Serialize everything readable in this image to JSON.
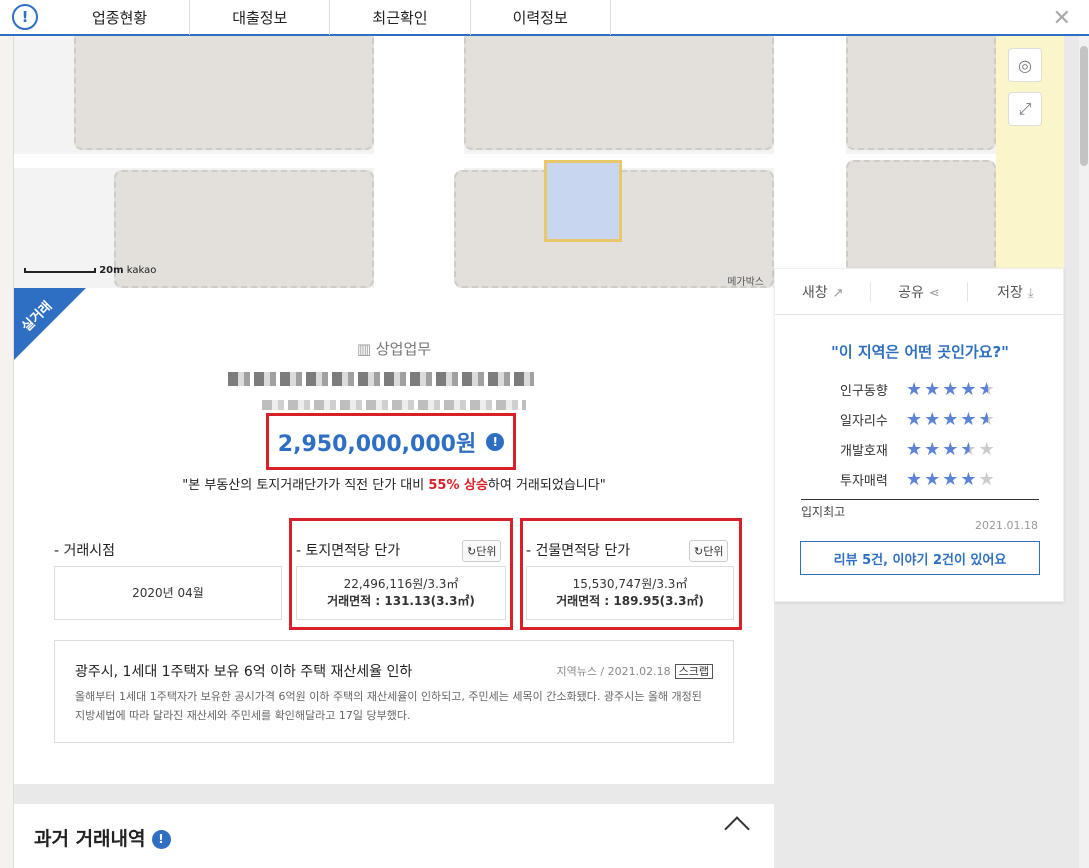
{
  "tabs": [
    "업종현황",
    "대출정보",
    "최근확인",
    "이력정보"
  ],
  "map": {
    "scale_label": "20m",
    "brand": "kakao",
    "poi_label": "메가박스"
  },
  "listing": {
    "badge": "실거래",
    "category": "상업업무",
    "price": "2,950,000,000원",
    "compare_prefix": "\"본 부동산의 토지거래단가가 직전 단가 대비 ",
    "compare_highlight": "55% 상승",
    "compare_suffix": "하여 거래되었습니다\"",
    "trade_time_label": "- 거래시점",
    "trade_time_value": "2020년 04월",
    "land_unit_title": "- 토지면적당 단가",
    "land_unit_price": "22,496,116원/3.3㎡",
    "land_area": "거래면적 : 131.13(3.3㎡)",
    "bldg_unit_title": "- 건물면적당 단가",
    "bldg_unit_price": "15,530,747원/3.3㎡",
    "bldg_area": "거래면적 : 189.95(3.3㎡)",
    "unit_button": "단위"
  },
  "news": {
    "title": "광주시, 1세대 1주택자 보유 6억 이하 주택 재산세율 인하",
    "source": "지역뉴스 / 2021.02.18",
    "scrap": "스크랩",
    "body": "올해부터 1세대 1주택자가 보유한 공시가격 6억원 이하 주택의 재산세율이 인하되고, 주민세는 세목이 간소화됐다. 광주시는 올해 개정된 지방세법에 따라 달라진 재산세와 주민세를 확인해달라고 17일 당부했다."
  },
  "past": {
    "title": "과거 거래내역"
  },
  "side": {
    "actions": [
      "새창",
      "공유",
      "저장"
    ],
    "question": "\"이 지역은 어떤 곳인가요?\"",
    "ratings": [
      {
        "label": "인구동향",
        "stars": 4.5
      },
      {
        "label": "일자리수",
        "stars": 4.5
      },
      {
        "label": "개발호재",
        "stars": 3.5
      },
      {
        "label": "투자매력",
        "stars": 4
      }
    ],
    "location_label": "입지최고",
    "date": "2021.01.18",
    "review_button": "리뷰 5건, 이야기 2건이 있어요"
  }
}
